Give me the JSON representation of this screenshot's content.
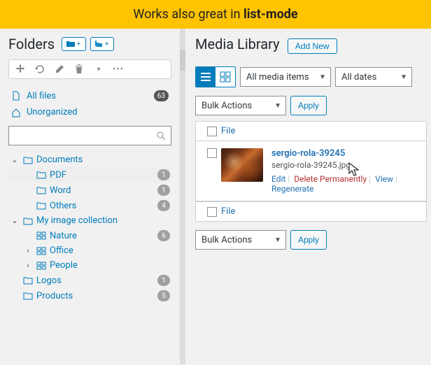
{
  "banner": {
    "prefix": "Works also great in ",
    "bold": "list-mode"
  },
  "folders": {
    "title": "Folders",
    "new_folder_btn": "+",
    "new_subfolder_btn": "+",
    "quick": {
      "all_files": {
        "label": "All files",
        "count": "63"
      },
      "unorganized": {
        "label": "Unorganized"
      }
    },
    "search": {
      "placeholder": ""
    },
    "tree": {
      "documents": {
        "label": "Documents",
        "expanded": true
      },
      "pdf": {
        "label": "PDF",
        "count": "1"
      },
      "word": {
        "label": "Word",
        "count": "1"
      },
      "others": {
        "label": "Others",
        "count": "4"
      },
      "my_image": {
        "label": "My image collection",
        "expanded": true
      },
      "nature": {
        "label": "Nature",
        "count": "6"
      },
      "office": {
        "label": "Office"
      },
      "people": {
        "label": "People"
      },
      "logos": {
        "label": "Logos",
        "count": "1"
      },
      "products": {
        "label": "Products",
        "count": "5"
      }
    }
  },
  "media": {
    "title": "Media Library",
    "add_new": "Add New",
    "filter_type": "All media items",
    "filter_date": "All dates",
    "bulk_actions": "Bulk Actions",
    "apply": "Apply",
    "col_file": "File",
    "items": {
      "0": {
        "title": "sergio-rola-39245",
        "filename": "sergio-rola-39245.jpg",
        "actions": {
          "edit": "Edit",
          "delete": "Delete Permanently",
          "view": "View",
          "regen": "Regenerate"
        }
      }
    }
  }
}
